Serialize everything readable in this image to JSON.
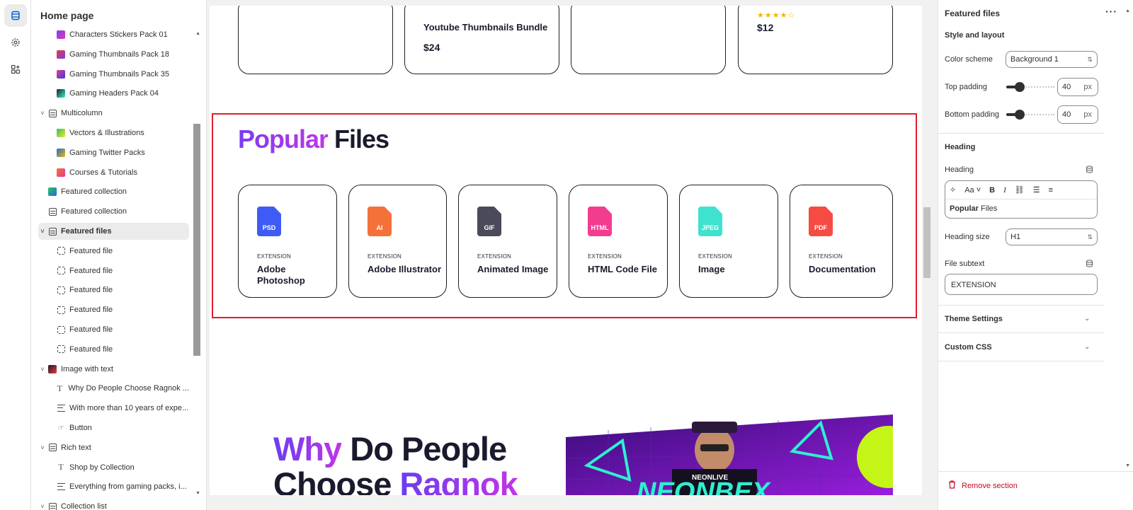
{
  "rail": {
    "icons": [
      "sections-icon",
      "settings-icon",
      "apps-icon"
    ]
  },
  "tree": {
    "title": "Home page",
    "items": [
      {
        "label": "Characters Stickers Pack 01",
        "kind": "thumb",
        "indent": 2
      },
      {
        "label": "Gaming Thumbnails Pack 18",
        "kind": "thumb",
        "indent": 2
      },
      {
        "label": "Gaming Thumbnails Pack 35",
        "kind": "thumb",
        "indent": 2
      },
      {
        "label": "Gaming Headers Pack 04",
        "kind": "thumb",
        "indent": 2
      },
      {
        "label": "Multicolumn",
        "kind": "section",
        "indent": 1,
        "chevron": true
      },
      {
        "label": "Vectors & Illustrations",
        "kind": "thumb",
        "indent": 2
      },
      {
        "label": "Gaming Twitter Packs",
        "kind": "thumb",
        "indent": 2
      },
      {
        "label": "Courses & Tutorials",
        "kind": "thumb",
        "indent": 2
      },
      {
        "label": "Featured collection",
        "kind": "thumb",
        "indent": 1
      },
      {
        "label": "Featured collection",
        "kind": "section",
        "indent": 1
      },
      {
        "label": "Featured files",
        "kind": "section",
        "indent": 1,
        "chevron": true,
        "selected": true
      },
      {
        "label": "Featured file",
        "kind": "block",
        "indent": 2
      },
      {
        "label": "Featured file",
        "kind": "block",
        "indent": 2
      },
      {
        "label": "Featured file",
        "kind": "block",
        "indent": 2
      },
      {
        "label": "Featured file",
        "kind": "block",
        "indent": 2
      },
      {
        "label": "Featured file",
        "kind": "block",
        "indent": 2
      },
      {
        "label": "Featured file",
        "kind": "block",
        "indent": 2
      },
      {
        "label": "Image with text",
        "kind": "thumb",
        "indent": 1,
        "chevron": true
      },
      {
        "label": "Why Do People Choose Ragnok ...",
        "kind": "text",
        "indent": 2
      },
      {
        "label": "With more than 10 years of expe...",
        "kind": "lines",
        "indent": 2
      },
      {
        "label": "Button",
        "kind": "button",
        "indent": 2
      },
      {
        "label": "Rich text",
        "kind": "section",
        "indent": 1,
        "chevron": true
      },
      {
        "label": "Shop by Collection",
        "kind": "text",
        "indent": 2
      },
      {
        "label": "Everything from gaming packs, i...",
        "kind": "lines",
        "indent": 2
      },
      {
        "label": "Collection list",
        "kind": "section",
        "indent": 1,
        "chevron": true
      }
    ]
  },
  "preview": {
    "top_products": [
      {
        "name": "",
        "price": "",
        "stars": ""
      },
      {
        "name": "Youtube Thumbnails Bundle",
        "price": "$24",
        "stars": ""
      },
      {
        "name": "",
        "price": "",
        "stars": ""
      },
      {
        "name": "",
        "price": "$12",
        "stars": "★★★★☆"
      }
    ],
    "heading_accent": "Popular",
    "heading_rest": "Files",
    "files": [
      {
        "tag": "PSD",
        "ext": "EXTENSION",
        "name": "Adobe Photoshop",
        "color": "#3f5bf5"
      },
      {
        "tag": "AI",
        "ext": "EXTENSION",
        "name": "Adobe Illustrator",
        "color": "#f5713a"
      },
      {
        "tag": "GIF",
        "ext": "EXTENSION",
        "name": "Animated Image",
        "color": "#4a4a58"
      },
      {
        "tag": "HTML",
        "ext": "EXTENSION",
        "name": "HTML Code File",
        "color": "#f23d8f"
      },
      {
        "tag": "JPEG",
        "ext": "EXTENSION",
        "name": "Image",
        "color": "#3fe2cf"
      },
      {
        "tag": "PDF",
        "ext": "EXTENSION",
        "name": "Documentation",
        "color": "#f54b42"
      }
    ],
    "why_line1_accent": "Why",
    "why_line1_rest": "Do People",
    "why_line2_rest": "Choose",
    "why_line2_accent": "Ragnok",
    "banner_text": "NEONLIVE",
    "banner_big": "NEONBEX"
  },
  "settings": {
    "title": "Featured files",
    "style_layout": "Style and layout",
    "color_scheme_label": "Color scheme",
    "color_scheme_value": "Background 1",
    "top_padding_label": "Top padding",
    "top_padding_value": "40",
    "bottom_padding_label": "Bottom padding",
    "bottom_padding_value": "40",
    "unit": "px",
    "heading_section": "Heading",
    "heading_label": "Heading",
    "heading_bold": "Popular",
    "heading_rest": " Files",
    "heading_size_label": "Heading size",
    "heading_size_value": "H1",
    "file_subtext_label": "File subtext",
    "file_subtext_value": "EXTENSION",
    "theme_settings": "Theme Settings",
    "custom_css": "Custom CSS",
    "remove_section": "Remove section"
  },
  "colors": {
    "accent": "#005bd3",
    "selection_outline": "#e41e2b",
    "danger": "#c70a24"
  }
}
